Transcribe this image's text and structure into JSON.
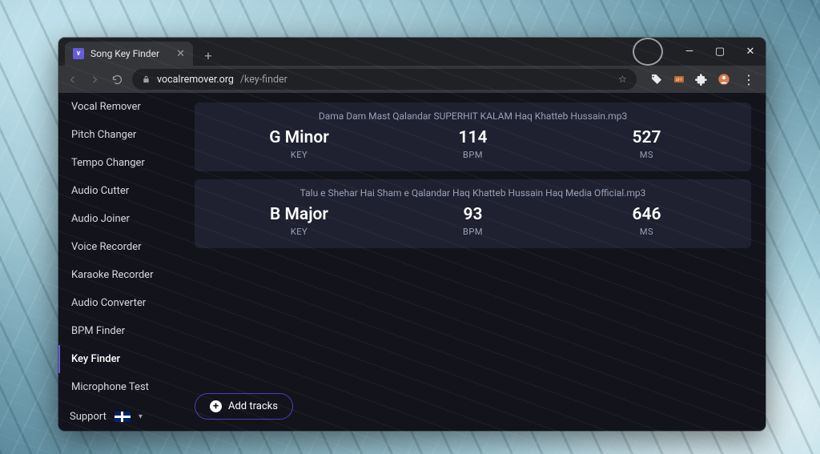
{
  "tab": {
    "favicon_letter": "v",
    "title": "Song Key Finder"
  },
  "address": {
    "host": "vocalremover.org",
    "path": "/key-finder"
  },
  "sidebar": {
    "items": [
      {
        "label": "Vocal Remover",
        "active": false
      },
      {
        "label": "Pitch Changer",
        "active": false
      },
      {
        "label": "Tempo Changer",
        "active": false
      },
      {
        "label": "Audio Cutter",
        "active": false
      },
      {
        "label": "Audio Joiner",
        "active": false
      },
      {
        "label": "Voice Recorder",
        "active": false
      },
      {
        "label": "Karaoke Recorder",
        "active": false
      },
      {
        "label": "Audio Converter",
        "active": false
      },
      {
        "label": "BPM Finder",
        "active": false
      },
      {
        "label": "Key Finder",
        "active": true
      },
      {
        "label": "Microphone Test",
        "active": false
      }
    ],
    "support_label": "Support"
  },
  "labels": {
    "key": "KEY",
    "bpm": "BPM",
    "ms": "MS"
  },
  "tracks": [
    {
      "filename": "Dama Dam Mast Qalandar SUPERHIT KALAM Haq Khatteb Hussain.mp3",
      "key": "G Minor",
      "bpm": "114",
      "ms": "527"
    },
    {
      "filename": "Talu e Shehar Hai Sham e Qalandar Haq Khatteb Hussain Haq Media Official.mp3",
      "key": "B Major",
      "bpm": "93",
      "ms": "646"
    }
  ],
  "buttons": {
    "add_tracks": "Add tracks"
  }
}
